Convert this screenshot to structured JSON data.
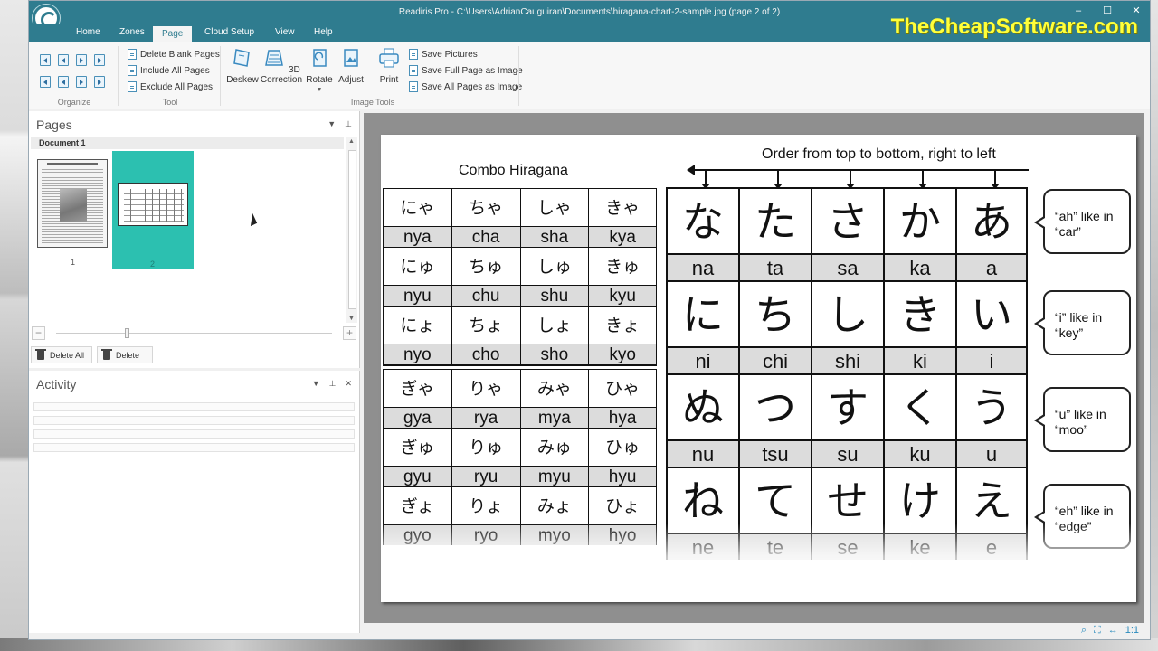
{
  "window": {
    "title": "Readiris Pro - C:\\Users\\AdrianCauguiran\\Documents\\hiragana-chart-2-sample.jpg (page 2 of 2)",
    "watermark": "TheCheapSoftware.com",
    "controls": {
      "minimize": "–",
      "maximize": "☐",
      "close": "✕"
    }
  },
  "ribbon_tabs": [
    "Home",
    "Zones",
    "Page",
    "Cloud Setup",
    "View",
    "Help"
  ],
  "active_tab": "Page",
  "ribbon": {
    "organize_label": "Organize",
    "tool_label": "Tool",
    "image_tools_label": "Image Tools",
    "tool_commands": [
      "Delete Blank Pages",
      "Include All Pages",
      "Exclude All Pages"
    ],
    "image_commands": [
      "Deskew",
      "3D Correction",
      "Rotate",
      "Adjust",
      "Print"
    ],
    "picture_commands": [
      "Save Pictures",
      "Save Full Page as Image",
      "Save All Pages as Image"
    ]
  },
  "pages_panel": {
    "title": "Pages",
    "document_label": "Document 1",
    "thumbnails": [
      {
        "number": "1"
      },
      {
        "number": "2"
      }
    ],
    "selected_page": "2",
    "buttons": {
      "delete_all": "Delete All",
      "delete": "Delete"
    }
  },
  "activity_panel": {
    "title": "Activity"
  },
  "document": {
    "combo_title": "Combo Hiragana",
    "order_title": "Order from top to bottom, right to left",
    "combo_rows": [
      {
        "kana": [
          "にゃ",
          "ちゃ",
          "しゃ",
          "きゃ"
        ],
        "roma": [
          "nya",
          "cha",
          "sha",
          "kya"
        ]
      },
      {
        "kana": [
          "にゅ",
          "ちゅ",
          "しゅ",
          "きゅ"
        ],
        "roma": [
          "nyu",
          "chu",
          "shu",
          "kyu"
        ]
      },
      {
        "kana": [
          "にょ",
          "ちょ",
          "しょ",
          "きょ"
        ],
        "roma": [
          "nyo",
          "cho",
          "sho",
          "kyo"
        ]
      },
      {
        "kana": [
          "ぎゃ",
          "りゃ",
          "みゃ",
          "ひゃ"
        ],
        "roma": [
          "gya",
          "rya",
          "mya",
          "hya"
        ]
      },
      {
        "kana": [
          "ぎゅ",
          "りゅ",
          "みゅ",
          "ひゅ"
        ],
        "roma": [
          "gyu",
          "ryu",
          "myu",
          "hyu"
        ]
      },
      {
        "kana": [
          "ぎょ",
          "りょ",
          "みょ",
          "ひょ"
        ],
        "roma": [
          "gyo",
          "ryo",
          "myo",
          "hyo"
        ]
      }
    ],
    "main_rows": [
      {
        "kana": [
          "な",
          "た",
          "さ",
          "か",
          "あ"
        ],
        "roma": [
          "na",
          "ta",
          "sa",
          "ka",
          "a"
        ]
      },
      {
        "kana": [
          "に",
          "ち",
          "し",
          "き",
          "い"
        ],
        "roma": [
          "ni",
          "chi",
          "shi",
          "ki",
          "i"
        ]
      },
      {
        "kana": [
          "ぬ",
          "つ",
          "す",
          "く",
          "う"
        ],
        "roma": [
          "nu",
          "tsu",
          "su",
          "ku",
          "u"
        ]
      },
      {
        "kana": [
          "ね",
          "て",
          "せ",
          "け",
          "え"
        ],
        "roma": [
          "ne",
          "te",
          "se",
          "ke",
          "e"
        ]
      }
    ],
    "notes": [
      {
        "line1": "“ah” like in",
        "line2": "“car”"
      },
      {
        "line1": "“i” like in",
        "line2": "“key”"
      },
      {
        "line1": "“u” like in",
        "line2": "“moo”"
      },
      {
        "line1": "“eh” like in",
        "line2": "“edge”"
      }
    ]
  },
  "statusbar": {
    "zoom": "1:1"
  }
}
